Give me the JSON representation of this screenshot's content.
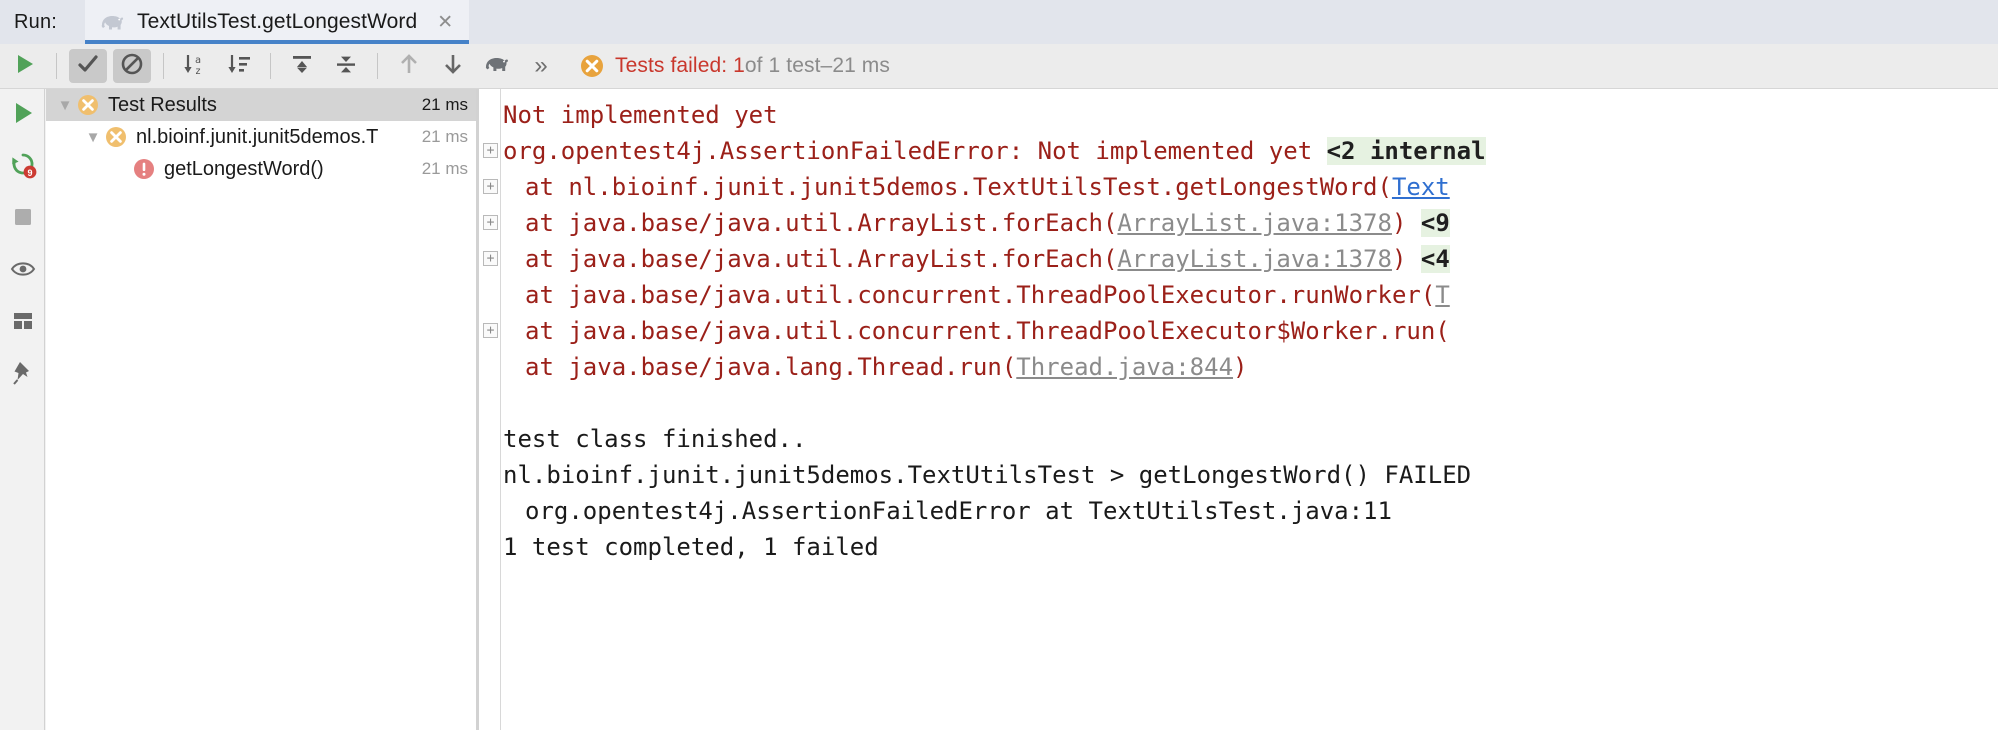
{
  "window": {
    "run_label": "Run:",
    "tab_title": "TextUtilsTest.getLongestWord",
    "tab_icon": "gradle-elephant-icon",
    "close_icon": "✕"
  },
  "toolbar": {
    "buttons": [
      {
        "name": "rerun-button",
        "icon": "play-icon"
      },
      {
        "name": "show-passed-toggle",
        "icon": "check-icon",
        "pressed": true
      },
      {
        "name": "show-ignored-toggle",
        "icon": "no-entry-icon",
        "pressed": true
      },
      {
        "name": "sort-alphabetically-button",
        "icon": "sort-alpha-icon"
      },
      {
        "name": "sort-by-duration-button",
        "icon": "sort-duration-icon"
      },
      {
        "name": "expand-all-button",
        "icon": "expand-all-icon"
      },
      {
        "name": "collapse-all-button",
        "icon": "collapse-all-icon"
      },
      {
        "name": "previous-failed-test-button",
        "icon": "arrow-up-icon"
      },
      {
        "name": "next-failed-test-button",
        "icon": "arrow-down-icon"
      },
      {
        "name": "gradle-settings-button",
        "icon": "gradle-elephant-icon"
      },
      {
        "name": "more-toolbar-actions-button",
        "icon": "chevron-double-right-icon"
      }
    ],
    "more_glyph": "»"
  },
  "status": {
    "icon": "test-failed-icon",
    "failed_text": "Tests failed: 1",
    "of_text": " of 1 test ",
    "dash": "–",
    "duration": " 21 ms"
  },
  "rail": {
    "buttons": [
      {
        "name": "rail-run-button",
        "icon": "play-green-icon"
      },
      {
        "name": "rail-rerun-failed-button",
        "icon": "rerun-failed-icon",
        "badge": "9"
      },
      {
        "name": "rail-stop-button",
        "icon": "stop-square-icon"
      },
      {
        "name": "rail-toggle-auto-test-button",
        "icon": "eye-icon"
      },
      {
        "name": "rail-layout-button",
        "icon": "layout-grid-icon"
      },
      {
        "name": "rail-pin-tab-button",
        "icon": "pin-icon"
      }
    ]
  },
  "tree": {
    "rows": [
      {
        "label": "Test Results",
        "time": "21 ms",
        "icon": "test-failed-icon",
        "twisty": "▼",
        "depth": 0,
        "selected": true,
        "time_style": "dark"
      },
      {
        "label": "nl.bioinf.junit.junit5demos.T",
        "time": "21 ms",
        "icon": "test-failed-icon",
        "twisty": "▼",
        "depth": 1,
        "selected": false,
        "time_style": "grey"
      },
      {
        "label": "getLongestWord()",
        "time": "21 ms",
        "icon": "test-error-icon",
        "twisty": "",
        "depth": 2,
        "selected": false,
        "time_style": "grey"
      }
    ]
  },
  "console": {
    "lines": [
      {
        "fold": "",
        "indent": 0,
        "parts": [
          {
            "t": " Not implemented yet",
            "s": "err"
          }
        ]
      },
      {
        "fold": "+",
        "indent": 0,
        "parts": [
          {
            "t": "org.opentest4j.AssertionFailedError: Not implemented yet ",
            "s": "err"
          },
          {
            "t": "<2 internal",
            "s": "hl"
          }
        ]
      },
      {
        "fold": "+",
        "indent": 1,
        "parts": [
          {
            "t": "at nl.bioinf.junit.junit5demos.TextUtilsTest.getLongestWord(",
            "s": "err"
          },
          {
            "t": "Text",
            "s": "bluelink"
          }
        ]
      },
      {
        "fold": "+",
        "indent": 1,
        "parts": [
          {
            "t": "at java.base/java.util.ArrayList.forEach(",
            "s": "err"
          },
          {
            "t": "ArrayList.java:1378",
            "s": "link"
          },
          {
            "t": ") ",
            "s": "err"
          },
          {
            "t": "<9",
            "s": "hl"
          }
        ]
      },
      {
        "fold": "+",
        "indent": 1,
        "parts": [
          {
            "t": "at java.base/java.util.ArrayList.forEach(",
            "s": "err"
          },
          {
            "t": "ArrayList.java:1378",
            "s": "link"
          },
          {
            "t": ") ",
            "s": "err"
          },
          {
            "t": "<4",
            "s": "hl"
          }
        ]
      },
      {
        "fold": "",
        "indent": 1,
        "parts": [
          {
            "t": "at java.base/java.util.concurrent.ThreadPoolExecutor.runWorker(",
            "s": "err"
          },
          {
            "t": "T",
            "s": "link"
          }
        ]
      },
      {
        "fold": "+",
        "indent": 1,
        "parts": [
          {
            "t": "at java.base/java.util.concurrent.ThreadPoolExecutor$Worker.run(",
            "s": "err"
          }
        ]
      },
      {
        "fold": "",
        "indent": 1,
        "parts": [
          {
            "t": "at java.base/java.lang.Thread.run(",
            "s": "err"
          },
          {
            "t": "Thread.java:844",
            "s": "link"
          },
          {
            "t": ")",
            "s": "err"
          }
        ]
      },
      {
        "fold": "",
        "indent": 0,
        "parts": []
      },
      {
        "fold": "",
        "indent": 0,
        "parts": [
          {
            "t": " test class finished..",
            "s": "plain"
          }
        ]
      },
      {
        "fold": "",
        "indent": 0,
        "parts": [
          {
            "t": " nl.bioinf.junit.junit5demos.TextUtilsTest > getLongestWord() FAILED",
            "s": "plain"
          }
        ]
      },
      {
        "fold": "",
        "indent": 1,
        "parts": [
          {
            "t": "org.opentest4j.AssertionFailedError at TextUtilsTest.java:11",
            "s": "plain"
          }
        ]
      },
      {
        "fold": "",
        "indent": 0,
        "parts": [
          {
            "t": " 1 test completed, 1 failed",
            "s": "plain"
          }
        ]
      }
    ]
  },
  "colors": {
    "error_red": "#9b2019",
    "status_red": "#c9372c",
    "status_icon": "#e8a33d",
    "tab_underline": "#4682c8",
    "highlight_green": "#e6f2e1",
    "link_grey": "#8b8b8b"
  }
}
